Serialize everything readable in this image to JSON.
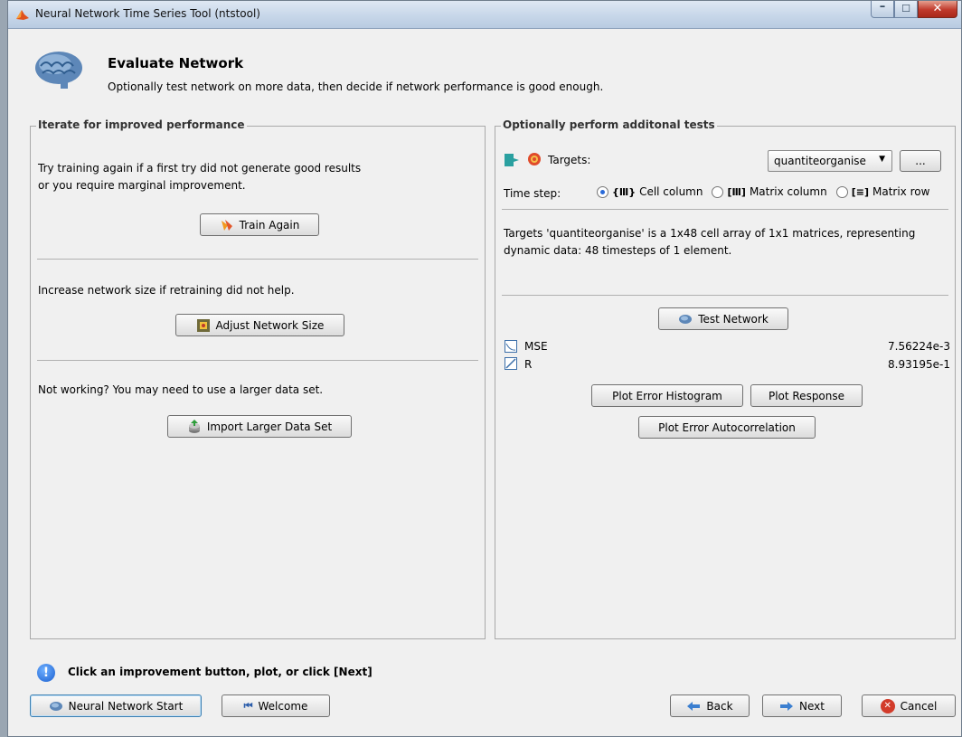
{
  "window": {
    "title": "Neural Network Time Series Tool (ntstool)"
  },
  "header": {
    "title": "Evaluate Network",
    "subtitle": "Optionally test network on more data, then decide if network performance is good enough."
  },
  "left_panel": {
    "legend": "Iterate for improved performance",
    "retrain_text_line1": "Try training again if a first try did not generate good results",
    "retrain_text_line2": "or you require marginal improvement.",
    "train_again_label": "Train Again",
    "size_text": "Increase network size if retraining did not help.",
    "adjust_size_label": "Adjust Network Size",
    "data_text": "Not working? You may need to use a larger data set.",
    "import_label": "Import Larger Data Set"
  },
  "right_panel": {
    "legend": "Optionally perform additonal tests",
    "targets_label": "Targets:",
    "targets_value": "quantiteorganise",
    "browse_label": "...",
    "timestep_label": "Time step:",
    "timestep_options": [
      "Cell column",
      "Matrix column",
      "Matrix row"
    ],
    "timestep_selected": "Cell column",
    "description_line1": "Targets 'quantiteorganise' is a 1x48 cell array of 1x1 matrices, representing",
    "description_line2": "dynamic data: 48 timesteps of 1 element.",
    "test_network_label": "Test Network",
    "results": [
      {
        "name": "MSE",
        "value": "7.56224e-3"
      },
      {
        "name": "R",
        "value": "8.93195e-1"
      }
    ],
    "plot_error_histogram_label": "Plot Error Histogram",
    "plot_response_label": "Plot Response",
    "plot_error_autocorrelation_label": "Plot Error Autocorrelation"
  },
  "status": {
    "message": "Click an improvement button, plot, or click [Next]"
  },
  "footer": {
    "nn_start_label": "Neural Network Start",
    "welcome_label": "Welcome",
    "back_label": "Back",
    "next_label": "Next",
    "cancel_label": "Cancel"
  },
  "colors": {
    "accent": "#1a5fd0",
    "titlebar": "#c9d8ea",
    "close": "#c0392b"
  }
}
